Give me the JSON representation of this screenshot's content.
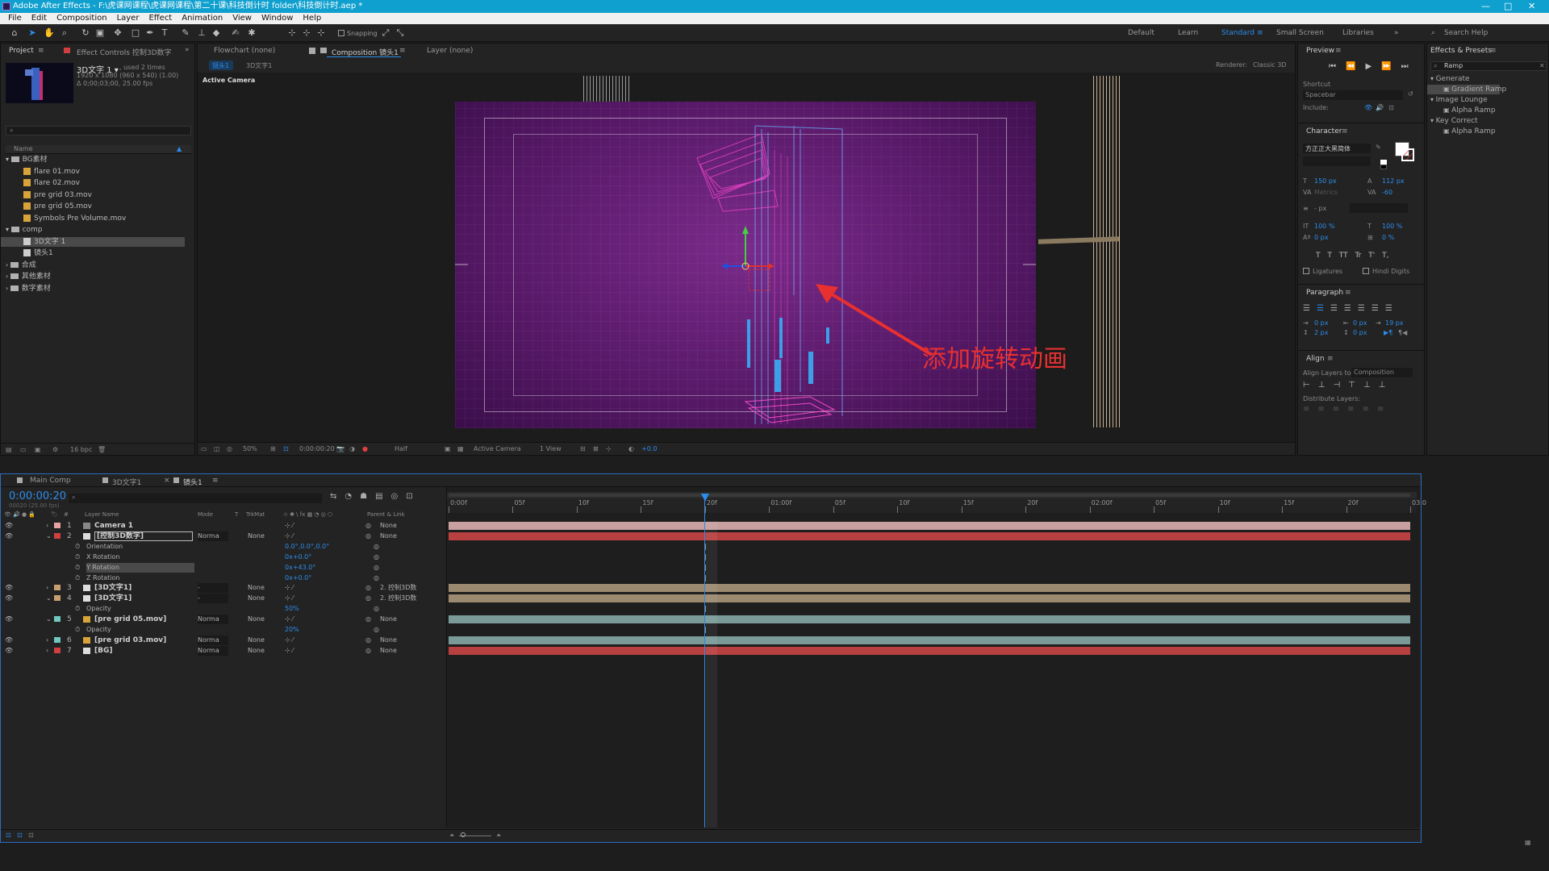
{
  "window": {
    "title": "Adobe After Effects - F:\\虎课网课程\\虎课网课程\\第二十课\\科技倒计时 folder\\科技倒计时.aep *",
    "controls": [
      "—",
      "□",
      "✕"
    ]
  },
  "menu": [
    "File",
    "Edit",
    "Composition",
    "Layer",
    "Effect",
    "Animation",
    "View",
    "Window",
    "Help"
  ],
  "toolbar": {
    "snapping": "Snapping",
    "workspaces": [
      "Default",
      "Learn",
      "Standard",
      "Small Screen",
      "Libraries"
    ],
    "search_help": "Search Help"
  },
  "project": {
    "tab": "Project",
    "effect_controls_tab": "Effect Controls 控制3D数字",
    "item_name": "3D文字 1 ▾",
    "used": ", used 2 times",
    "size": "1920 x 1080 (960 x 540) (1.00)",
    "duration": "Δ 0;00;03;00, 25.00 fps",
    "col_name": "Name",
    "tree": [
      {
        "label": "BG素材",
        "type": "folder",
        "level": 0
      },
      {
        "label": "flare 01.mov",
        "type": "mov",
        "level": 1
      },
      {
        "label": "flare 02.mov",
        "type": "mov",
        "level": 1
      },
      {
        "label": "pre grid 03.mov",
        "type": "mov",
        "level": 1
      },
      {
        "label": "pre grid 05.mov",
        "type": "mov",
        "level": 1
      },
      {
        "label": "Symbols Pre Volume.mov",
        "type": "mov",
        "level": 1
      },
      {
        "label": "comp",
        "type": "folder",
        "level": 0
      },
      {
        "label": "3D文字 1",
        "type": "comp",
        "level": 1,
        "selected": true
      },
      {
        "label": "镜头1",
        "type": "comp",
        "level": 1
      },
      {
        "label": "合成",
        "type": "folder",
        "level": 0
      },
      {
        "label": "其他素材",
        "type": "folder",
        "level": 0
      },
      {
        "label": "数字素材",
        "type": "folder",
        "level": 0
      }
    ],
    "bpc": "16 bpc"
  },
  "viewer": {
    "tabs": [
      "Flowchart (none)",
      "Composition 镜头1",
      "Layer (none)"
    ],
    "crumbs": [
      "镜头1",
      "3D文字1"
    ],
    "renderer": "Renderer:",
    "renderer_val": "Classic 3D",
    "active_camera": "Active Camera",
    "annotation": "添加旋转动画",
    "bottom": {
      "zoom": "50%",
      "time": "0:00:00:20",
      "resolution": "Half",
      "view": "Active Camera",
      "views": "1 View",
      "exposure": "+0.0"
    }
  },
  "preview": {
    "title": "Preview",
    "shortcut_label": "Shortcut",
    "shortcut": "Spacebar",
    "include": "Include:"
  },
  "character": {
    "title": "Character",
    "font": "方正正大黑简体",
    "size": "150 px",
    "leading": "112 px",
    "kerning": "Metrics",
    "tracking": "-60",
    "stroke": "- px",
    "vscale": "100 %",
    "hscale": "100 %",
    "baseline": "0 px",
    "tsume": "0 %",
    "ligatures": "Ligatures",
    "hindi": "Hindi Digits",
    "styles": [
      "T",
      "T",
      "TT",
      "Tr",
      "T'",
      "T,"
    ]
  },
  "paragraph": {
    "title": "Paragraph",
    "indent1": "0 px",
    "indent2": "0 px",
    "indent3": "19 px",
    "space1": "2 px",
    "space2": "0 px"
  },
  "align": {
    "title": "Align",
    "align_to_label": "Align Layers to:",
    "align_to": "Composition",
    "distribute": "Distribute Layers:"
  },
  "effects": {
    "title": "Effects & Presets",
    "search": "Ramp",
    "tree": [
      {
        "label": "Generate",
        "level": 0
      },
      {
        "label": "Gradient Ramp",
        "level": 1,
        "selected": true
      },
      {
        "label": "Image Lounge",
        "level": 0
      },
      {
        "label": "Alpha Ramp",
        "level": 1
      },
      {
        "label": "Key Correct",
        "level": 0
      },
      {
        "label": "Alpha Ramp",
        "level": 1
      }
    ]
  },
  "timeline": {
    "tabs": [
      "Main Comp",
      "3D文字1",
      "镜头1"
    ],
    "timecode": "0:00:00:20",
    "frames": "00020 (25.00 fps)",
    "columns": {
      "layer": "Layer Name",
      "mode": "Mode",
      "t": "T",
      "trkmat": "TrkMat",
      "parent": "Parent & Link"
    },
    "ruler": [
      "0:00f",
      "05f",
      "10f",
      "15f",
      "20f",
      "01:00f",
      "05f",
      "10f",
      "15f",
      "20f",
      "02:00f",
      "05f",
      "10f",
      "15f",
      "20f",
      "03:0"
    ],
    "playhead_fraction": 0.267,
    "rows": [
      {
        "num": "1",
        "name": "Camera 1",
        "mode": "",
        "trk": "",
        "parent": "None",
        "color": "#e8a0a0",
        "bar": "#c8a0a0",
        "kind": "layer"
      },
      {
        "num": "2",
        "name": "[控制3D数字]",
        "mode": "Norma",
        "trk": "None",
        "parent": "None",
        "color": "#d04040",
        "bar": "#b84040",
        "kind": "layer",
        "selected": true
      },
      {
        "name": "Orientation",
        "value": "0.0°,0.0°,0.0°",
        "kind": "prop"
      },
      {
        "name": "X Rotation",
        "value": "0x+0.0°",
        "kind": "prop"
      },
      {
        "name": "Y Rotation",
        "value": "0x+43.0°",
        "kind": "prop",
        "selected": true
      },
      {
        "name": "Z Rotation",
        "value": "0x+0.0°",
        "kind": "prop"
      },
      {
        "num": "3",
        "name": "[3D文字1]",
        "mode": "-",
        "trk": "None",
        "parent": "2. 控制3D数",
        "color": "#c8a070",
        "bar": "#9c8a70",
        "kind": "layer"
      },
      {
        "num": "4",
        "name": "[3D文字1]",
        "mode": "-",
        "trk": "None",
        "parent": "2. 控制3D数",
        "color": "#c8a070",
        "bar": "#9c8a70",
        "kind": "layer"
      },
      {
        "name": "Opacity",
        "value": "50%",
        "kind": "prop"
      },
      {
        "num": "5",
        "name": "[pre grid 05.mov]",
        "mode": "Norma",
        "trk": "None",
        "parent": "None",
        "color": "#70c8c0",
        "bar": "#7a9a98",
        "kind": "layer"
      },
      {
        "name": "Opacity",
        "value": "20%",
        "kind": "prop"
      },
      {
        "num": "6",
        "name": "[pre grid 03.mov]",
        "mode": "Norma",
        "trk": "None",
        "parent": "None",
        "color": "#70c8c0",
        "bar": "#7a9a98",
        "kind": "layer"
      },
      {
        "num": "7",
        "name": "[BG]",
        "mode": "Norma",
        "trk": "None",
        "parent": "None",
        "color": "#d04040",
        "bar": "#b84040",
        "kind": "layer"
      }
    ]
  },
  "colors": {
    "accent": "#2d8ceb",
    "title_bar": "#10a0cf",
    "comp_bg": "#5a1a6a",
    "annotation": "#e83030"
  }
}
